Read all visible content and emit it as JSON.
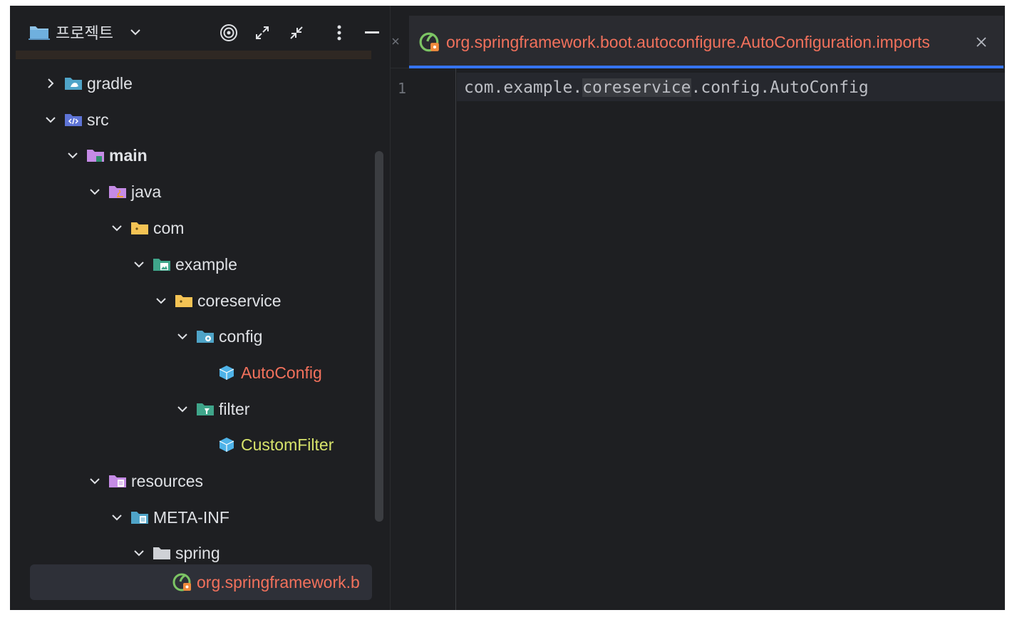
{
  "project_panel": {
    "title": "프로젝트",
    "tree": [
      {
        "label": "gradle",
        "expanded": false,
        "icon": "folder-gradle-icon"
      },
      {
        "label": "src",
        "expanded": true,
        "icon": "folder-source-root-icon"
      },
      {
        "label": "main",
        "expanded": true,
        "icon": "folder-module-icon"
      },
      {
        "label": "java",
        "expanded": true,
        "icon": "folder-java-icon"
      },
      {
        "label": "com",
        "expanded": true,
        "icon": "package-folder-icon"
      },
      {
        "label": "example",
        "expanded": true,
        "icon": "package-folder-image-icon"
      },
      {
        "label": "coreservice",
        "expanded": true,
        "icon": "package-folder-icon"
      },
      {
        "label": "config",
        "expanded": true,
        "icon": "package-config-icon"
      },
      {
        "label": "AutoConfig",
        "icon": "java-class-icon",
        "status": "error"
      },
      {
        "label": "filter",
        "expanded": true,
        "icon": "package-filter-icon"
      },
      {
        "label": "CustomFilter",
        "icon": "java-class-icon",
        "status": "new"
      },
      {
        "label": "resources",
        "expanded": true,
        "icon": "folder-resources-icon"
      },
      {
        "label": "META-INF",
        "expanded": true,
        "icon": "folder-meta-inf-icon"
      },
      {
        "label": "spring",
        "expanded": true,
        "icon": "folder-plain-icon"
      },
      {
        "label": "org.springframework.b",
        "icon": "spring-file-icon",
        "status": "error",
        "selected": true
      }
    ]
  },
  "editor": {
    "tab": {
      "label": "org.springframework.boot.autoconfigure.AutoConfiguration.imports",
      "icon": "spring-file-icon"
    },
    "line_number": "1",
    "code": {
      "part1": "com.example.",
      "highlight": "coreservice",
      "part2": ".config.AutoConfig"
    }
  },
  "colors": {
    "background": "#1e1f22",
    "text": "#dfe1e5",
    "error": "#f2715c",
    "new_file": "#d7e36b",
    "accent": "#3574f0"
  }
}
